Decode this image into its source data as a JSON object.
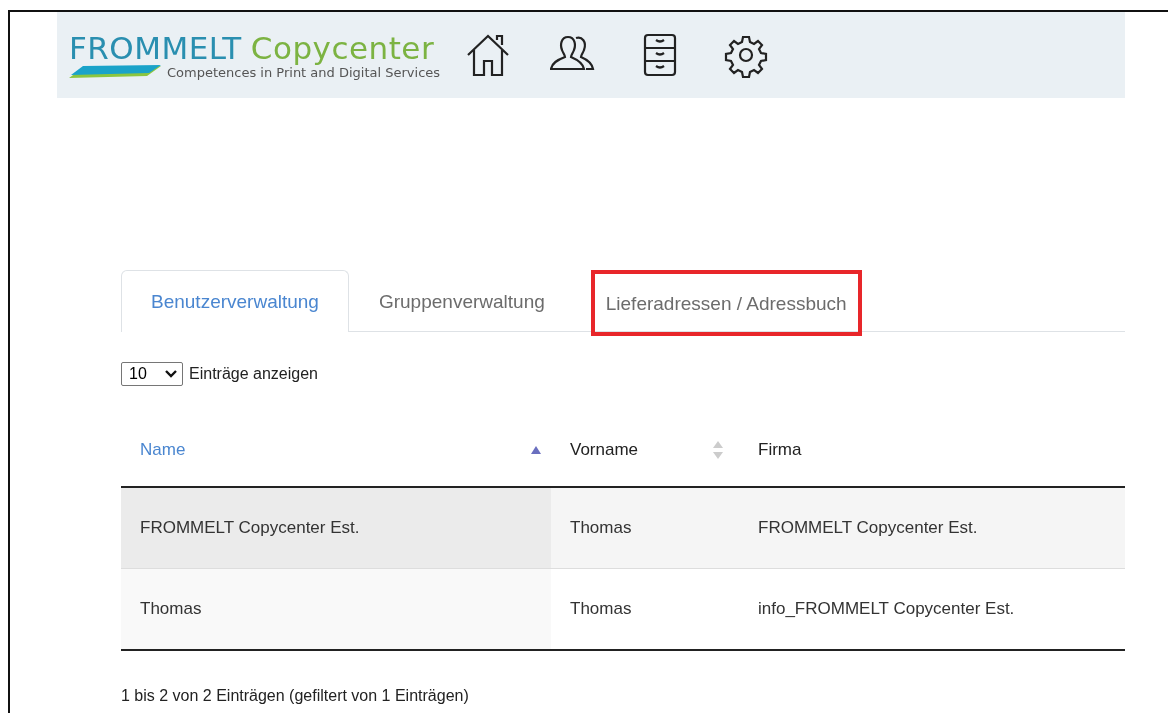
{
  "header": {
    "logo": {
      "brand_1": "FROMMELT",
      "brand_2": "Copycenter",
      "tagline": "Competences in Print and Digital Services"
    },
    "nav_icons": [
      {
        "kind": "home"
      },
      {
        "kind": "users"
      },
      {
        "kind": "cabinet"
      },
      {
        "kind": "settings"
      }
    ]
  },
  "tabs": [
    {
      "label": "Benutzerverwaltung",
      "selected": true,
      "highlighted": false
    },
    {
      "label": "Gruppenverwaltung",
      "selected": false,
      "highlighted": false
    },
    {
      "label": "Lieferadressen / Adressbuch",
      "selected": false,
      "highlighted": true
    }
  ],
  "page_length": {
    "value": "10",
    "label": "Einträge anzeigen"
  },
  "table": {
    "columns": [
      {
        "label": "Name",
        "sortable": true,
        "sorted": true
      },
      {
        "label": "Vorname",
        "sortable": true,
        "sorted": false
      },
      {
        "label": "Firma",
        "sortable": false,
        "sorted": false
      }
    ],
    "rows": [
      [
        "FROMMELT Copycenter Est.",
        "Thomas",
        "FROMMELT Copycenter Est."
      ],
      [
        "Thomas",
        "Thomas",
        "info_FROMMELT Copycenter Est."
      ]
    ]
  },
  "info": "1 bis 2 von 2 Einträgen (gefiltert von 1 Einträgen)"
}
